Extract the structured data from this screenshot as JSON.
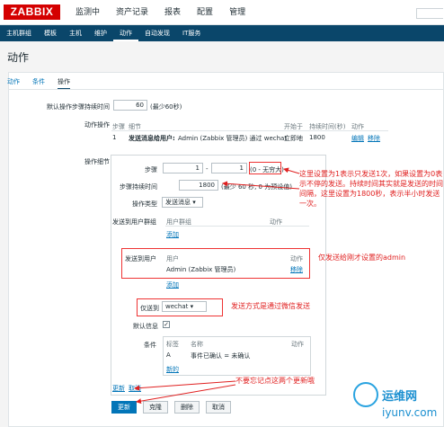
{
  "brand": "ZABBIX",
  "top_menu": [
    "监测中",
    "资产记录",
    "报表",
    "配置",
    "管理"
  ],
  "sub_menu": [
    "主机群组",
    "模板",
    "主机",
    "维护",
    "动作",
    "自动发现",
    "IT服务"
  ],
  "page_title": "动作",
  "tabs": [
    "动作",
    "条件",
    "操作"
  ],
  "form": {
    "default_step_duration_label": "默认操作步骤持续时间",
    "default_step_duration_value": "60",
    "default_step_duration_hint": "(最少60秒)",
    "operations_label": "动作操作",
    "ops_header": {
      "steps": "步骤",
      "details": "细节",
      "start_in": "开始于",
      "duration": "持续时间(秒)",
      "action": "动作"
    },
    "ops_row": {
      "step": "1",
      "details_bold": "发送消息给用户:",
      "details_rest": "Admin (Zabbix 管理员) 通过 wechat",
      "start_in": "立即地",
      "duration": "1800",
      "edit": "编辑",
      "remove": "移除"
    },
    "op_details_label": "操作细节",
    "steps_label": "步骤",
    "step_from": "1",
    "step_to": "1",
    "step_hint": "(0 - 无穷大)",
    "step_duration_label": "步骤持续时间",
    "step_duration_value": "1800",
    "step_duration_hint": "(最少 60 秒, 0 为预设值)",
    "op_type_label": "操作类型",
    "op_type_value": "发送消息",
    "send_to_groups_label": "发送到用户群组",
    "group_col": "用户群组",
    "group_action_col": "动作",
    "group_add": "添加",
    "send_to_users_label": "发送到用户",
    "user_col": "用户",
    "user_action_col": "动作",
    "user_row": "Admin (Zabbix 管理员)",
    "user_remove": "移除",
    "user_add": "添加",
    "send_only_to_label": "仅送到",
    "send_only_to_value": "wechat",
    "default_msg_label": "默认信息",
    "conditions_label": "条件",
    "cond_label_col": "标签",
    "cond_name_col": "名称",
    "cond_action_col": "动作",
    "cond_row_label": "A",
    "cond_row_name": "事件已确认 = 未确认",
    "cond_new": "新的",
    "update_link": "更新",
    "cancel_link": "取消",
    "btn_update": "更新",
    "btn_clone": "克隆",
    "btn_delete": "删除",
    "btn_cancel": "取消"
  },
  "annotations": {
    "a1": "这里设置为1表示只发送1次，如果设置为0表示不停的发送。持续时间其实就是发送的时间间隔，这里设置为1800秒，表示半小时发送一次。",
    "a2": "仅发送给刚才设置的admin",
    "a3": "发送方式是通过微信发送",
    "a4": "不要忘记点这两个更新哦"
  },
  "watermark": {
    "name": "运维网",
    "url": "iyunv.com"
  }
}
